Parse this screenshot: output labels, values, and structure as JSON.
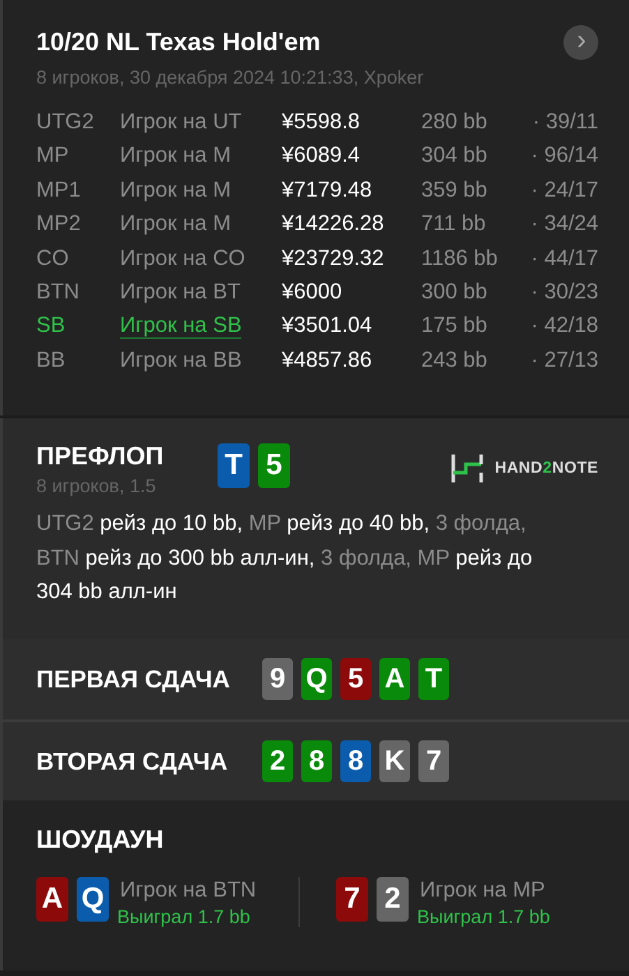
{
  "header": {
    "title": "10/20 NL Texas Hold'em",
    "subtitle": "8 игроков, 30 декабря 2024 10:21:33, Xpoker",
    "next_button": "›"
  },
  "players": [
    {
      "position": "UTG2",
      "name": "Игрок на UT",
      "stack": "¥5598.8",
      "bb": "280 bb",
      "stats": "· 39/11",
      "hero": false
    },
    {
      "position": "MP",
      "name": "Игрок на M",
      "stack": "¥6089.4",
      "bb": "304 bb",
      "stats": "· 96/14",
      "hero": false
    },
    {
      "position": "MP1",
      "name": "Игрок на M",
      "stack": "¥7179.48",
      "bb": "359 bb",
      "stats": "· 24/17",
      "hero": false
    },
    {
      "position": "MP2",
      "name": "Игрок на M",
      "stack": "¥14226.28",
      "bb": "711 bb",
      "stats": "· 34/24",
      "hero": false
    },
    {
      "position": "CO",
      "name": "Игрок на CO",
      "stack": "¥23729.32",
      "bb": "1186 bb",
      "stats": "· 44/17",
      "hero": false
    },
    {
      "position": "BTN",
      "name": "Игрок на BT",
      "stack": "¥6000",
      "bb": "300 bb",
      "stats": "· 30/23",
      "hero": false
    },
    {
      "position": "SB",
      "name": "Игрок на SB",
      "stack": "¥3501.04",
      "bb": "175 bb",
      "stats": "· 42/18",
      "hero": true
    },
    {
      "position": "BB",
      "name": "Игрок на BB",
      "stack": "¥4857.86",
      "bb": "243 bb",
      "stats": "· 27/13",
      "hero": false
    }
  ],
  "preflop": {
    "title": "ПРЕФЛОП",
    "subtitle": "8 игроков, 1.5",
    "cards": [
      {
        "rank": "T",
        "color": "#0b5cad"
      },
      {
        "rank": "5",
        "color": "#0a8a0a"
      }
    ],
    "logo": [
      {
        "text": "HAND",
        "accent": false
      },
      {
        "text": "2",
        "accent": true
      },
      {
        "text": "NOTE",
        "accent": false
      }
    ],
    "actions": [
      {
        "text": "UTG2",
        "kind": "actor"
      },
      {
        "text": " рейз до 10 bb, ",
        "kind": "action"
      },
      {
        "text": "MP",
        "kind": "actor"
      },
      {
        "text": " рейз до 40 bb, ",
        "kind": "action"
      },
      {
        "text": "3 фолда, ",
        "kind": "actor"
      },
      {
        "text": "BTN",
        "kind": "actor"
      },
      {
        "text": " рейз до 300 bb алл-ин, ",
        "kind": "action"
      },
      {
        "text": "3 фолда, MP",
        "kind": "actor"
      },
      {
        "text": " рейз до 304 bb алл-ин",
        "kind": "action"
      }
    ]
  },
  "boards": [
    {
      "title": "ПЕРВАЯ СДАЧА",
      "cards": [
        {
          "rank": "9",
          "color": "#666666"
        },
        {
          "rank": "Q",
          "color": "#0a8a0a"
        },
        {
          "rank": "5",
          "color": "#8c0a0a"
        },
        {
          "rank": "A",
          "color": "#0a8a0a"
        },
        {
          "rank": "T",
          "color": "#0a8a0a"
        }
      ]
    },
    {
      "title": "ВТОРАЯ СДАЧА",
      "cards": [
        {
          "rank": "2",
          "color": "#0a8a0a"
        },
        {
          "rank": "8",
          "color": "#0a8a0a"
        },
        {
          "rank": "8",
          "color": "#0b5cad"
        },
        {
          "rank": "K",
          "color": "#666666"
        },
        {
          "rank": "7",
          "color": "#666666"
        }
      ]
    }
  ],
  "showdown": {
    "title": "ШОУДАУН",
    "hands": [
      {
        "cards": [
          {
            "rank": "A",
            "color": "#8c0a0a"
          },
          {
            "rank": "Q",
            "color": "#0b5cad"
          }
        ],
        "player": "Игрок на BTN",
        "result": "Выиграл 1.7 bb"
      },
      {
        "cards": [
          {
            "rank": "7",
            "color": "#8c0a0a"
          },
          {
            "rank": "2",
            "color": "#666666"
          }
        ],
        "player": "Игрок на MP",
        "result": "Выиграл 1.7 bb"
      }
    ]
  }
}
